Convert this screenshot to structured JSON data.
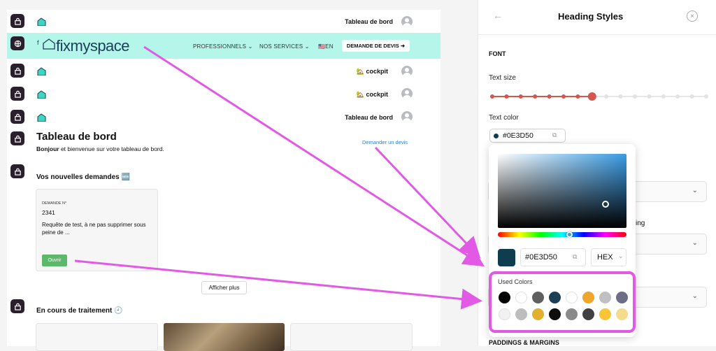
{
  "canvas": {
    "row1_name": "Tableau de bord",
    "nav": {
      "logo_text": "fixmyspace",
      "menu": [
        "PROFESSIONNELS",
        "NOS SERVICES"
      ],
      "lang": "🇺🇸EN",
      "cta": "DEMANDE DE DEVIS ➜"
    },
    "row3_name": "🏡 cockpit",
    "row4_name": "🏡 cockpit",
    "row5_name": "Tableau de bord",
    "dashboard": {
      "title": "Tableau de bord",
      "greeting_bold": "Bonjour",
      "greeting_rest": " et bienvenue sur votre tableau de bord.",
      "quote_link": "Demander un devis"
    },
    "new_requests": {
      "title": "Vos nouvelles demandes 🆕",
      "card_label": "DEMANDE N°",
      "card_number": "2341",
      "card_text": "Requête de test, à ne pas supprimer sous peine de ...",
      "open_button": "Ouvrir",
      "more_button": "Afficher plus"
    },
    "in_progress_title": "En cours de traitement 🕘"
  },
  "panel": {
    "title": "Heading Styles",
    "section_font": "FONT",
    "text_size_label": "Text size",
    "text_size_level": 7,
    "text_size_steps": 16,
    "text_color_label": "Text color",
    "color_value": "#0E3D50",
    "right_fragment": "ing",
    "section_paddings": "PADDINGS & MARGINS",
    "accent_color": "#d2574f"
  },
  "picker": {
    "hex_value": "#0E3D50",
    "format": "HEX",
    "used_colors_label": "Used Colors",
    "used_colors": [
      "#000000",
      "#ffffff",
      "#5f5f5f",
      "#1b3f57",
      "#ffffff",
      "#f0a62a",
      "#c0c0c2",
      "#6d6e86",
      "#f1f1f1",
      "#bdbdbd",
      "#e3b02d",
      "#0d0d0d",
      "#8a8a8a",
      "#414141",
      "#f8c535",
      "#f5db8b"
    ],
    "highlight_color": "#e259e6"
  }
}
